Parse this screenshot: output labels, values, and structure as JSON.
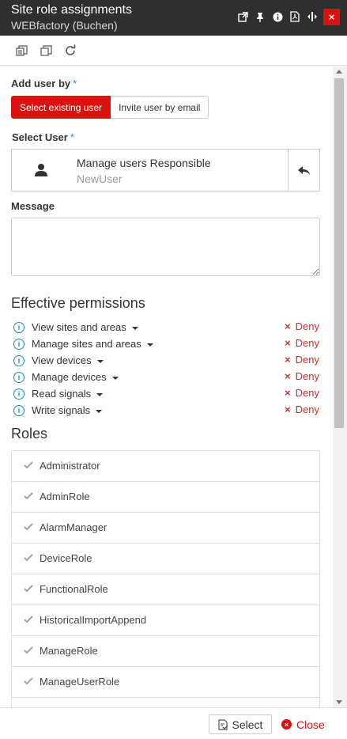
{
  "header": {
    "title": "Site role assignments",
    "subtitle": "WEBfactory (Buchen)",
    "icons": [
      "popout-icon",
      "pin-icon",
      "info-icon",
      "pdf-icon",
      "resize-icon",
      "close-icon"
    ],
    "close_glyph": "×"
  },
  "toolbar": {
    "icons": [
      "copy-icon",
      "duplicate-icon",
      "refresh-icon"
    ]
  },
  "form": {
    "add_user_by_label": "Add user by",
    "required_mark": "*",
    "select_existing_label": "Select existing user",
    "invite_by_email_label": "Invite user by email",
    "select_user_label": "Select User",
    "selected_user": {
      "name": "Manage users Responsible",
      "username": "NewUser"
    },
    "message_label": "Message",
    "message_value": ""
  },
  "permissions": {
    "title": "Effective permissions",
    "info_glyph": "i",
    "deny_glyph": "×",
    "items": [
      {
        "name": "View sites and areas",
        "state": "Deny"
      },
      {
        "name": "Manage sites and areas",
        "state": "Deny"
      },
      {
        "name": "View devices",
        "state": "Deny"
      },
      {
        "name": "Manage devices",
        "state": "Deny"
      },
      {
        "name": "Read signals",
        "state": "Deny"
      },
      {
        "name": "Write signals",
        "state": "Deny"
      }
    ]
  },
  "roles": {
    "title": "Roles",
    "items": [
      "Administrator",
      "AdminRole",
      "AlarmManager",
      "DeviceRole",
      "FunctionalRole",
      "HistoricalImportAppend",
      "ManageRole",
      "ManageUserRole"
    ]
  },
  "footer": {
    "select_label": "Select",
    "close_label": "Close",
    "close_glyph": "×"
  },
  "colors": {
    "accent_red": "#d9120f",
    "header_bg": "#2f2f2f",
    "info_blue": "#1a8fc9",
    "deny_red": "#c9302c"
  }
}
